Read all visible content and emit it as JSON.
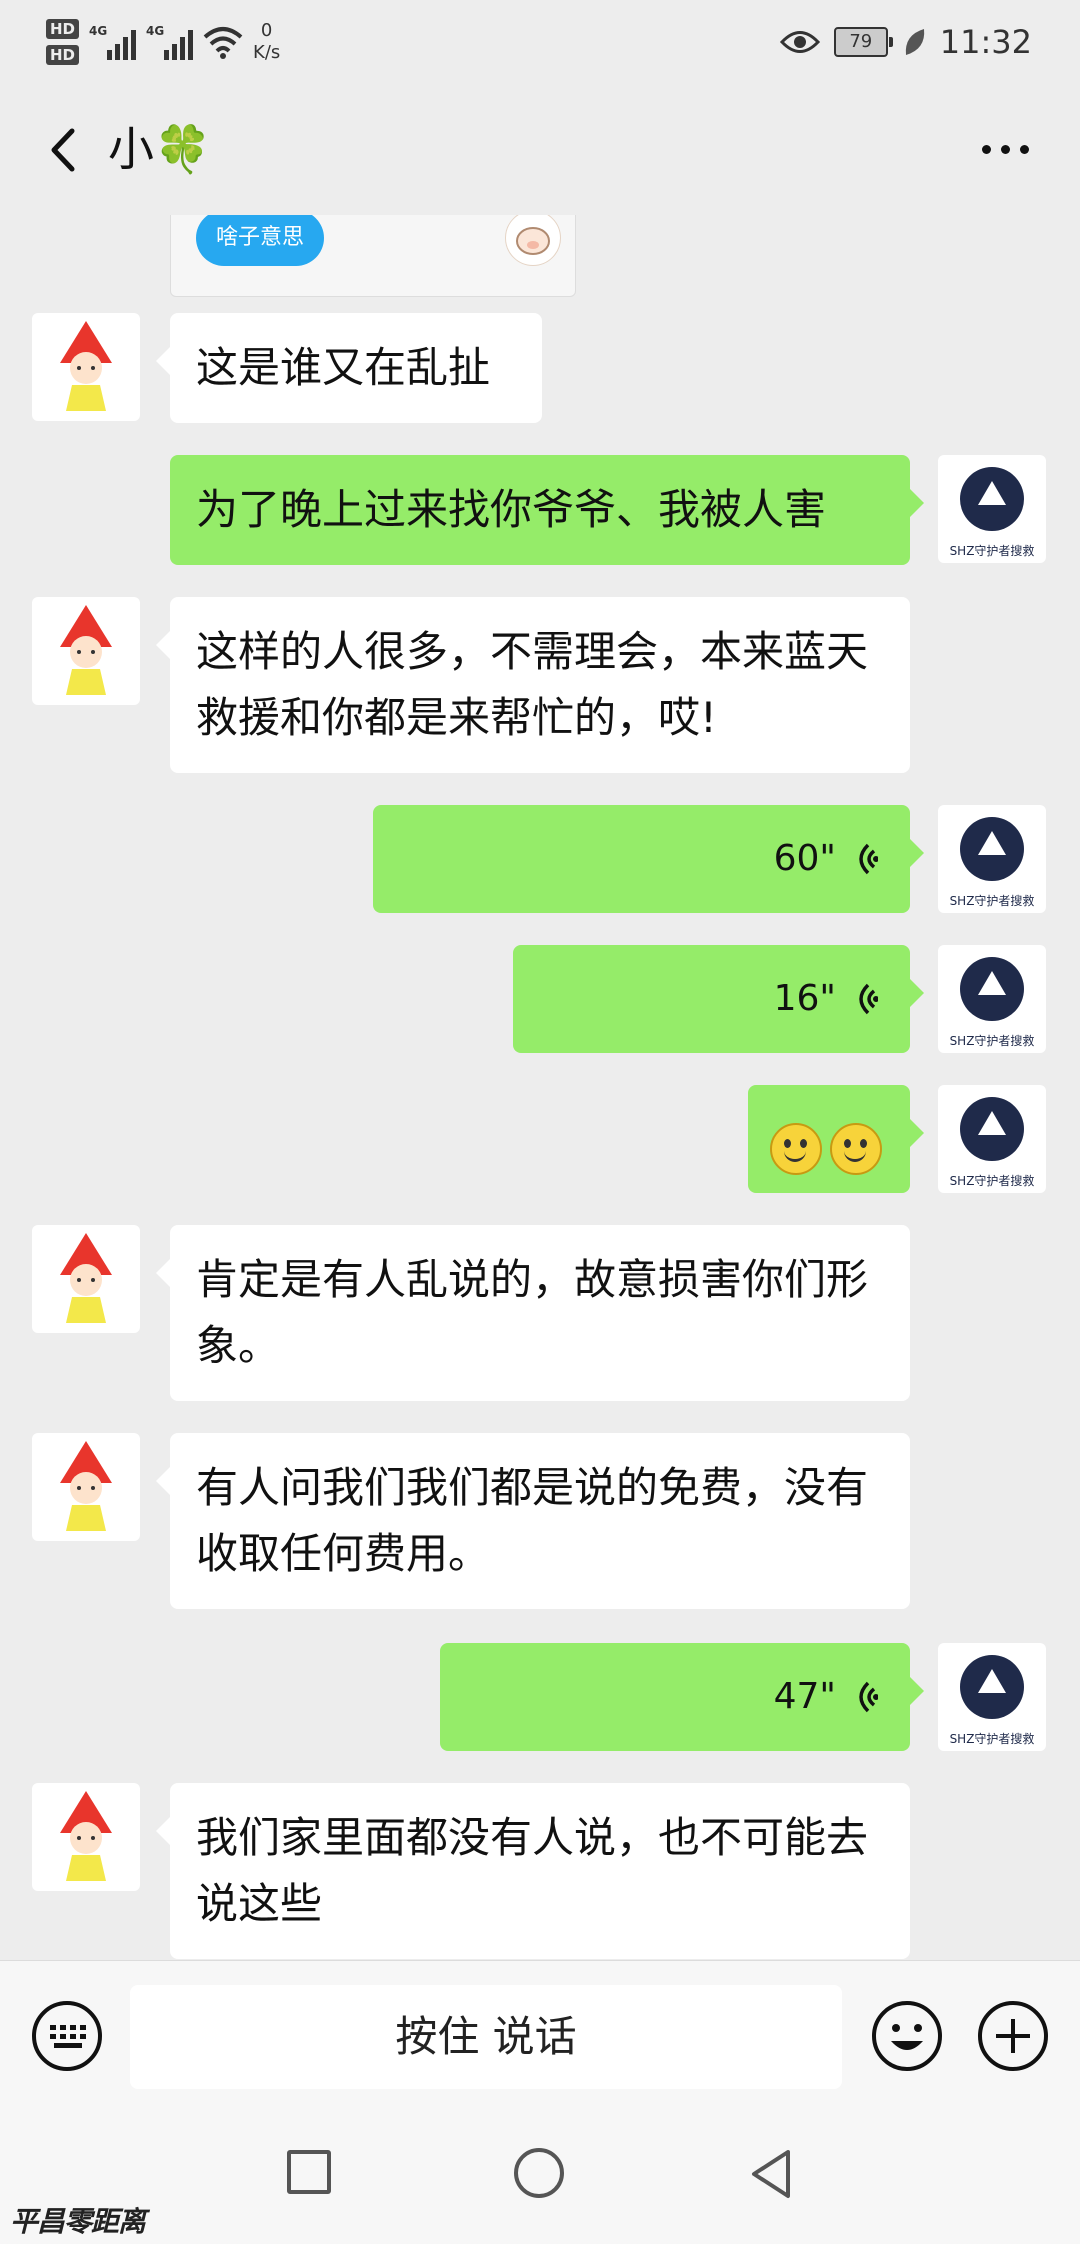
{
  "status_bar": {
    "hd1": "HD",
    "hd2": "HD",
    "sim1_tag": "4G",
    "sim2_tag": "4G",
    "net_speed_value": "0",
    "net_speed_unit": "K/s",
    "battery": "79",
    "time": "11:32"
  },
  "header": {
    "title": "小🍀",
    "more_label": "···"
  },
  "quoted": {
    "bubble_text": "啥子意思"
  },
  "messages": [
    {
      "side": "in",
      "type": "text",
      "text": "这是谁又在乱扯"
    },
    {
      "side": "out",
      "type": "text",
      "text": "为了晚上过来找你爷爷、我被人害"
    },
    {
      "side": "in",
      "type": "text",
      "text": "这样的人很多，不需理会，本来蓝天救援和你都是来帮忙的，哎!"
    },
    {
      "side": "out",
      "type": "voice",
      "duration": "60\""
    },
    {
      "side": "out",
      "type": "voice",
      "duration": "16\""
    },
    {
      "side": "out",
      "type": "emoji",
      "count": 2
    },
    {
      "side": "in",
      "type": "text",
      "text": "肯定是有人乱说的，故意损害你们形象。"
    },
    {
      "side": "in",
      "type": "text",
      "text": "有人问我们我们都是说的免费，没有收取任何费用。"
    },
    {
      "side": "out",
      "type": "voice",
      "duration": "47\""
    },
    {
      "side": "in",
      "type": "text",
      "text": "我们家里面都没有人说，也不可能去说这些"
    }
  ],
  "my_avatar_caption": "SHZ守护者搜救",
  "input_bar": {
    "hold_to_talk": "按住 说话"
  },
  "watermark": "平昌零距离",
  "colors": {
    "background": "#ededed",
    "outgoing_bubble": "#95ec69",
    "incoming_bubble": "#ffffff",
    "quoted_bubble": "#27a8f0"
  }
}
